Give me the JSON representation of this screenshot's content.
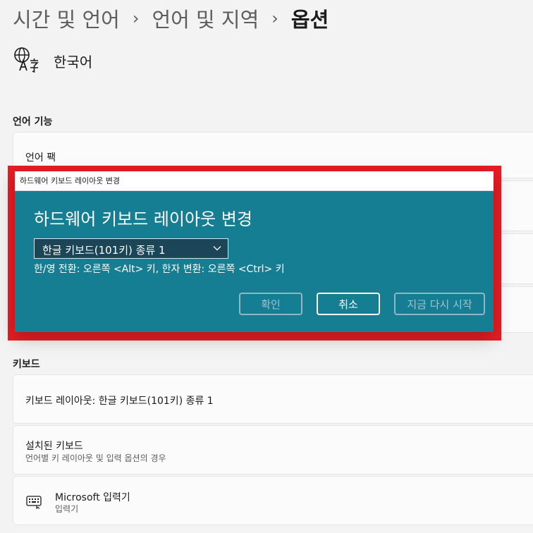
{
  "breadcrumb": {
    "item1": "시간 및 언어",
    "item2": "언어 및 지역",
    "current": "옵션",
    "separator": "›"
  },
  "language": {
    "name": "한국어",
    "icon": "language-icon"
  },
  "sections": {
    "language_features": {
      "title": "언어 기능",
      "language_pack": "언어 팩"
    },
    "keyboard": {
      "title": "키보드",
      "layout_card": "키보드 레이아웃: 한글 키보드(101키) 종류 1",
      "installed_title": "설치된 키보드",
      "installed_sub": "언어별 키 레이아웃 및 입력 옵션의 경우",
      "ime_title": "Microsoft 입력기",
      "ime_sub": "입력기",
      "ime_icon": "keyboard-icon"
    }
  },
  "dialog": {
    "window_title": "하드웨어 키보드 레이아웃 변경",
    "heading": "하드웨어 키보드 레이아웃 변경",
    "select_value": "한글 키보드(101키) 종류 1",
    "hint": "한/영 전환: 오른쪽 <Alt> 키, 한자 변환: 오른쪽 <Ctrl> 키",
    "buttons": {
      "ok": "확인",
      "cancel": "취소",
      "restart": "지금 다시 시작"
    }
  },
  "colors": {
    "dialog_bg": "#167e93",
    "highlight": "#e81d24",
    "page_bg": "#f3f3f3"
  }
}
